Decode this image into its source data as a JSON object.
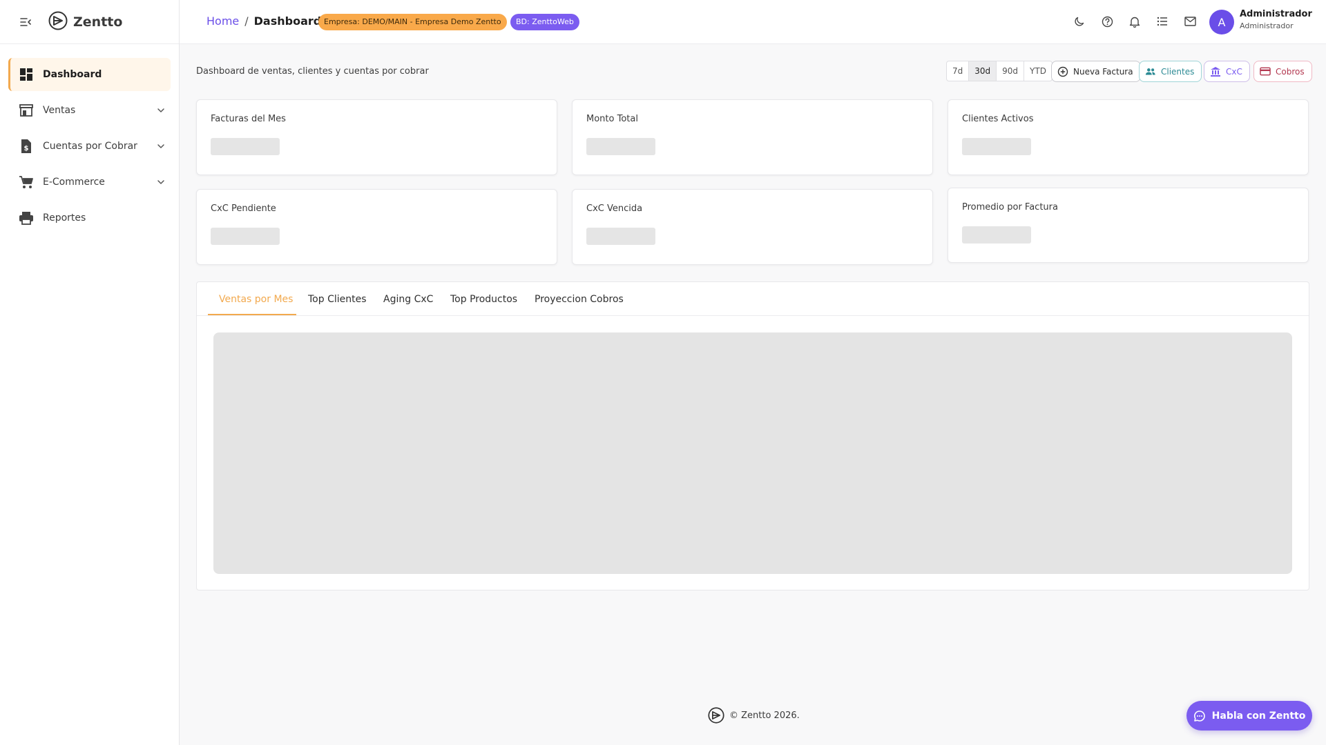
{
  "app": {
    "brand": "Zentto"
  },
  "sidebar": {
    "items": [
      {
        "label": "Dashboard",
        "icon": "dashboard-icon",
        "active": true
      },
      {
        "label": "Ventas",
        "icon": "store-icon",
        "expandable": true
      },
      {
        "label": "Cuentas por Cobrar",
        "icon": "invoice-dollar-icon",
        "expandable": true
      },
      {
        "label": "E-Commerce",
        "icon": "cart-icon",
        "expandable": true
      },
      {
        "label": "Reportes",
        "icon": "printer-icon"
      }
    ]
  },
  "header": {
    "breadcrumb": {
      "home": "Home",
      "separator": "/",
      "current": "Dashboard"
    },
    "company_chip": "Empresa: DEMO/MAIN - Empresa Demo Zentto",
    "db_chip": "BD: ZenttoWeb",
    "icons": [
      "moon-icon",
      "help-icon",
      "bell-icon",
      "list-icon",
      "mail-icon"
    ],
    "user": {
      "initial": "A",
      "name": "Administrador",
      "role": "Administrador"
    }
  },
  "page": {
    "subtitle": "Dashboard de ventas, clientes y cuentas por cobrar",
    "ranges": [
      {
        "label": "7d",
        "active": false
      },
      {
        "label": "30d",
        "active": true
      },
      {
        "label": "90d",
        "active": false
      },
      {
        "label": "YTD",
        "active": false
      }
    ],
    "actions": {
      "nueva_factura": "Nueva Factura",
      "clientes": "Clientes",
      "cxc": "CxC",
      "cobros": "Cobros"
    }
  },
  "kpis": [
    {
      "title": "Facturas del Mes"
    },
    {
      "title": "Monto Total"
    },
    {
      "title": "Clientes Activos"
    },
    {
      "title": "CxC Pendiente"
    },
    {
      "title": "CxC Vencida"
    },
    {
      "title": "Promedio por Factura"
    }
  ],
  "tabs": [
    {
      "label": "Ventas por Mes",
      "active": true
    },
    {
      "label": "Top Clientes"
    },
    {
      "label": "Aging CxC"
    },
    {
      "label": "Top Productos"
    },
    {
      "label": "Proyeccion Cobros"
    }
  ],
  "footer": {
    "text": "© Zentto 2026."
  },
  "chat": {
    "label": "Habla con Zentto"
  },
  "colors": {
    "accent": "#f2a94e",
    "brand": "#6a4ee8",
    "chat": "#7b5cf0"
  }
}
